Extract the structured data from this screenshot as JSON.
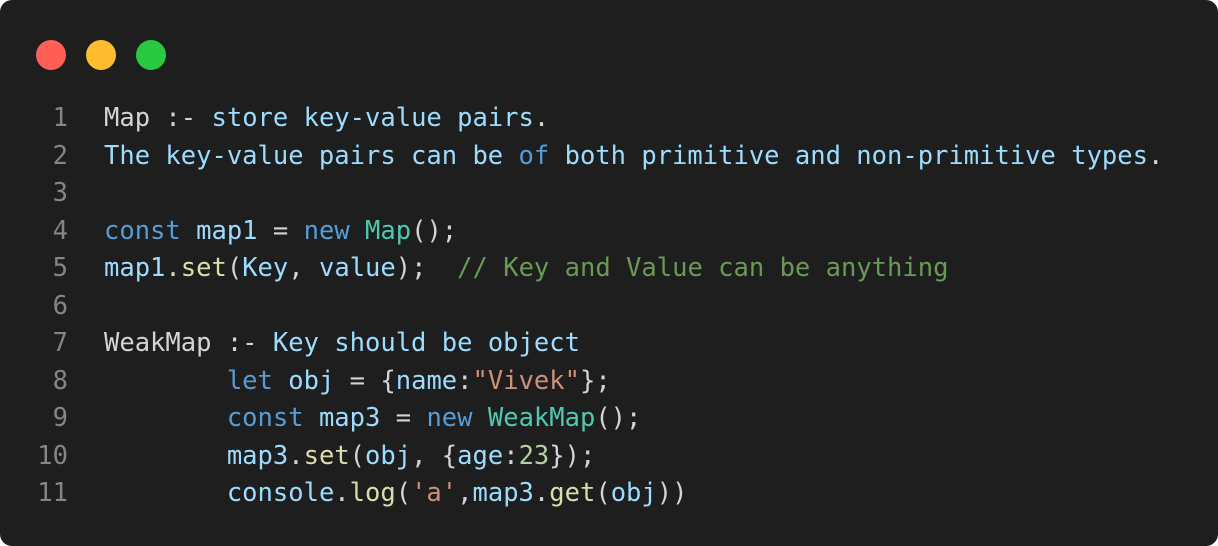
{
  "window": {
    "controls": [
      "close",
      "minimize",
      "maximize"
    ],
    "colors": {
      "background": "#1e1e1e",
      "close": "#ff5f57",
      "minimize": "#febc2e",
      "maximize": "#28c840"
    }
  },
  "lines": [
    {
      "number": "1",
      "tokens": [
        {
          "t": "Map",
          "c": "plain"
        },
        {
          "t": " :- ",
          "c": "plain"
        },
        {
          "t": "store key-value pairs",
          "c": "var"
        },
        {
          "t": ".",
          "c": "plain"
        }
      ]
    },
    {
      "number": "2",
      "tokens": [
        {
          "t": "The key-value pairs can be ",
          "c": "var"
        },
        {
          "t": "of",
          "c": "kw"
        },
        {
          "t": " both primitive and non-primitive types",
          "c": "var"
        },
        {
          "t": ".",
          "c": "plain"
        }
      ]
    },
    {
      "number": "3",
      "tokens": []
    },
    {
      "number": "4",
      "tokens": [
        {
          "t": "const",
          "c": "kw"
        },
        {
          "t": " ",
          "c": "plain"
        },
        {
          "t": "map1",
          "c": "var"
        },
        {
          "t": " = ",
          "c": "op"
        },
        {
          "t": "new",
          "c": "kw"
        },
        {
          "t": " ",
          "c": "plain"
        },
        {
          "t": "Map",
          "c": "cls"
        },
        {
          "t": "();",
          "c": "plain"
        }
      ]
    },
    {
      "number": "5",
      "tokens": [
        {
          "t": "map1",
          "c": "var"
        },
        {
          "t": ".",
          "c": "plain"
        },
        {
          "t": "set",
          "c": "fn"
        },
        {
          "t": "(",
          "c": "plain"
        },
        {
          "t": "Key",
          "c": "var"
        },
        {
          "t": ", ",
          "c": "plain"
        },
        {
          "t": "value",
          "c": "var"
        },
        {
          "t": ");  ",
          "c": "plain"
        },
        {
          "t": "// Key and Value can be anything",
          "c": "cmt"
        }
      ]
    },
    {
      "number": "6",
      "tokens": []
    },
    {
      "number": "7",
      "tokens": [
        {
          "t": "WeakMap",
          "c": "plain"
        },
        {
          "t": " :- ",
          "c": "plain"
        },
        {
          "t": "Key should be object",
          "c": "var"
        }
      ]
    },
    {
      "number": "8",
      "tokens": [
        {
          "t": "        ",
          "c": "plain"
        },
        {
          "t": "let",
          "c": "kw"
        },
        {
          "t": " ",
          "c": "plain"
        },
        {
          "t": "obj",
          "c": "var"
        },
        {
          "t": " = {",
          "c": "plain"
        },
        {
          "t": "name",
          "c": "var"
        },
        {
          "t": ":",
          "c": "plain"
        },
        {
          "t": "\"Vivek\"",
          "c": "str"
        },
        {
          "t": "};",
          "c": "plain"
        }
      ]
    },
    {
      "number": "9",
      "tokens": [
        {
          "t": "        ",
          "c": "plain"
        },
        {
          "t": "const",
          "c": "kw"
        },
        {
          "t": " ",
          "c": "plain"
        },
        {
          "t": "map3",
          "c": "var"
        },
        {
          "t": " = ",
          "c": "op"
        },
        {
          "t": "new",
          "c": "kw"
        },
        {
          "t": " ",
          "c": "plain"
        },
        {
          "t": "WeakMap",
          "c": "cls"
        },
        {
          "t": "();",
          "c": "plain"
        }
      ]
    },
    {
      "number": "10",
      "tokens": [
        {
          "t": "        ",
          "c": "plain"
        },
        {
          "t": "map3",
          "c": "var"
        },
        {
          "t": ".",
          "c": "plain"
        },
        {
          "t": "set",
          "c": "fn"
        },
        {
          "t": "(",
          "c": "plain"
        },
        {
          "t": "obj",
          "c": "var"
        },
        {
          "t": ", {",
          "c": "plain"
        },
        {
          "t": "age",
          "c": "var"
        },
        {
          "t": ":",
          "c": "plain"
        },
        {
          "t": "23",
          "c": "num"
        },
        {
          "t": "});",
          "c": "plain"
        }
      ]
    },
    {
      "number": "11",
      "tokens": [
        {
          "t": "        ",
          "c": "plain"
        },
        {
          "t": "console",
          "c": "var"
        },
        {
          "t": ".",
          "c": "plain"
        },
        {
          "t": "log",
          "c": "fn"
        },
        {
          "t": "(",
          "c": "plain"
        },
        {
          "t": "'a'",
          "c": "str"
        },
        {
          "t": ",",
          "c": "plain"
        },
        {
          "t": "map3",
          "c": "var"
        },
        {
          "t": ".",
          "c": "plain"
        },
        {
          "t": "get",
          "c": "fn"
        },
        {
          "t": "(",
          "c": "plain"
        },
        {
          "t": "obj",
          "c": "var"
        },
        {
          "t": "))",
          "c": "plain"
        }
      ]
    }
  ]
}
